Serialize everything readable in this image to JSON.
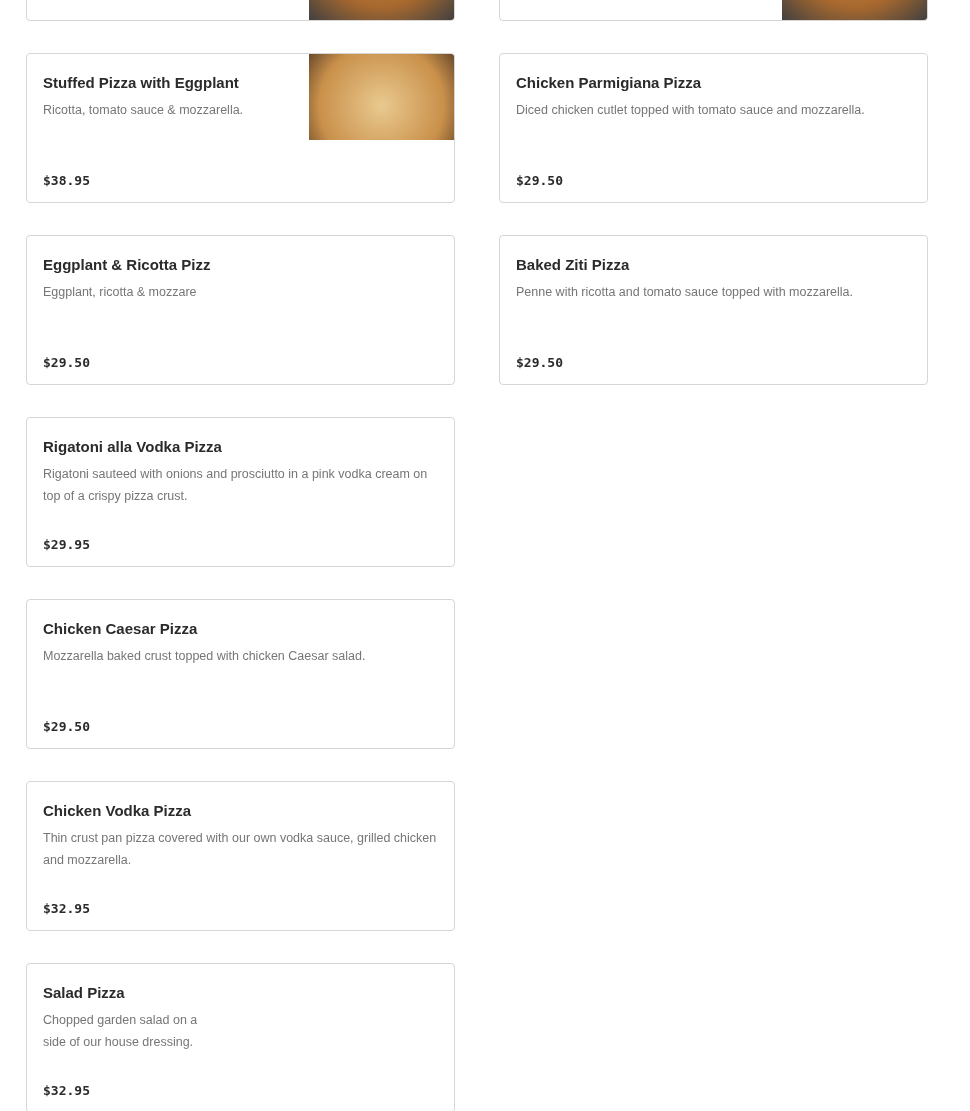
{
  "columns": [
    {
      "top_card": {
        "photo": true
      },
      "items": [
        {
          "name": "Stuffed Pizza with Eggplant",
          "description": [
            "Ricotta, tomato sauce & mozzarella."
          ],
          "price": "$38.95",
          "photo": true
        },
        {
          "name": "Eggplant & Ricotta Pizz",
          "description": [
            "Eggplant, ricotta & mozzare"
          ],
          "price": "$29.50",
          "photo": false
        },
        {
          "name": "Rigatoni alla Vodka Pizza",
          "description": [
            "Rigatoni sauteed with onions and prosciutto in a pink vodka cream on top of a crispy pizza crust."
          ],
          "price": "$29.95",
          "photo": false
        },
        {
          "name": "Chicken Caesar Pizza",
          "description": [
            "Mozzarella baked crust topped with chicken Caesar salad."
          ],
          "price": "$29.50",
          "photo": false
        },
        {
          "name": "Chicken Vodka Pizza",
          "description": [
            "Thin crust pan pizza covered with our own vodka sauce, grilled chicken and mozzarella."
          ],
          "price": "$32.95",
          "photo": false
        },
        {
          "name": "Salad Pizza",
          "description": [
            "Chopped garden salad on a",
            "side of our house dressing."
          ],
          "price": "$32.95",
          "photo": false
        }
      ]
    },
    {
      "top_card": {
        "photo": true
      },
      "items": [
        {
          "name": "Chicken Parmigiana Pizza",
          "description": [
            "Diced chicken cutlet topped with tomato sauce and mozzarella."
          ],
          "price": "$29.50",
          "photo": false
        },
        {
          "name": "Baked Ziti Pizza",
          "description": [
            "Penne with ricotta and tomato sauce topped with mozzarella."
          ],
          "price": "$29.50",
          "photo": false
        }
      ]
    }
  ]
}
